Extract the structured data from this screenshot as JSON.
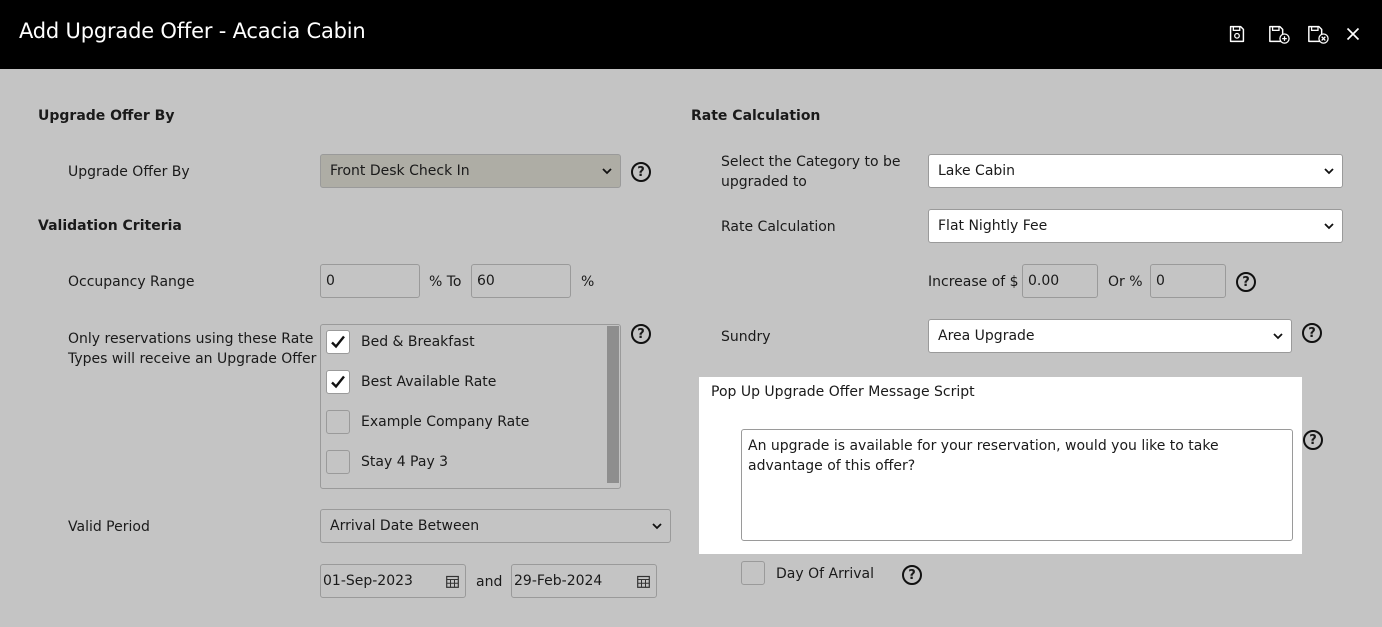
{
  "window": {
    "title": "Add Upgrade Offer - Acacia Cabin"
  },
  "toolbar": {
    "icons": [
      "save-icon",
      "save-new-icon",
      "save-close-icon",
      "close-icon"
    ]
  },
  "upgrade_offer_by": {
    "section_title": "Upgrade Offer By",
    "label": "Upgrade Offer By",
    "value": "Front Desk Check In"
  },
  "validation": {
    "section_title": "Validation Criteria",
    "occupancy_label": "Occupancy Range",
    "occupancy_from": "0",
    "occupancy_to_label": "% To",
    "occupancy_to": "60",
    "occupancy_suffix": "%",
    "rate_types_label_1": "Only reservations using these Rate",
    "rate_types_label_2": "Types will receive an Upgrade Offer",
    "rate_types": [
      {
        "label": "Bed & Breakfast",
        "checked": true
      },
      {
        "label": "Best Available Rate",
        "checked": true
      },
      {
        "label": "Example Company Rate",
        "checked": false
      },
      {
        "label": "Stay 4 Pay 3",
        "checked": false
      }
    ],
    "valid_period_label": "Valid Period",
    "valid_period_value": "Arrival Date Between",
    "date_from": "01-Sep-2023",
    "date_and": "and",
    "date_to": "29-Feb-2024"
  },
  "rate_calc": {
    "section_title": "Rate Calculation",
    "category_label_1": "Select the Category to be",
    "category_label_2": "upgraded to",
    "category_value": "Lake Cabin",
    "calc_label": "Rate Calculation",
    "calc_value": "Flat Nightly Fee",
    "increase_label": "Increase of $",
    "increase_value": "0.00",
    "or_pct_label": "Or %",
    "pct_value": "0",
    "sundry_label": "Sundry",
    "sundry_value": "Area Upgrade"
  },
  "popup": {
    "title": "Pop Up Upgrade Offer Message Script",
    "message": "An upgrade is available for your reservation, would you like to take advantage of this offer?"
  },
  "day_of_arrival": {
    "label": "Day Of Arrival",
    "checked": false
  },
  "help_glyph": "?",
  "colors": {
    "header_bg": "#000000",
    "page_bg": "#c4c4c4",
    "popup_bg": "#ffffff"
  }
}
